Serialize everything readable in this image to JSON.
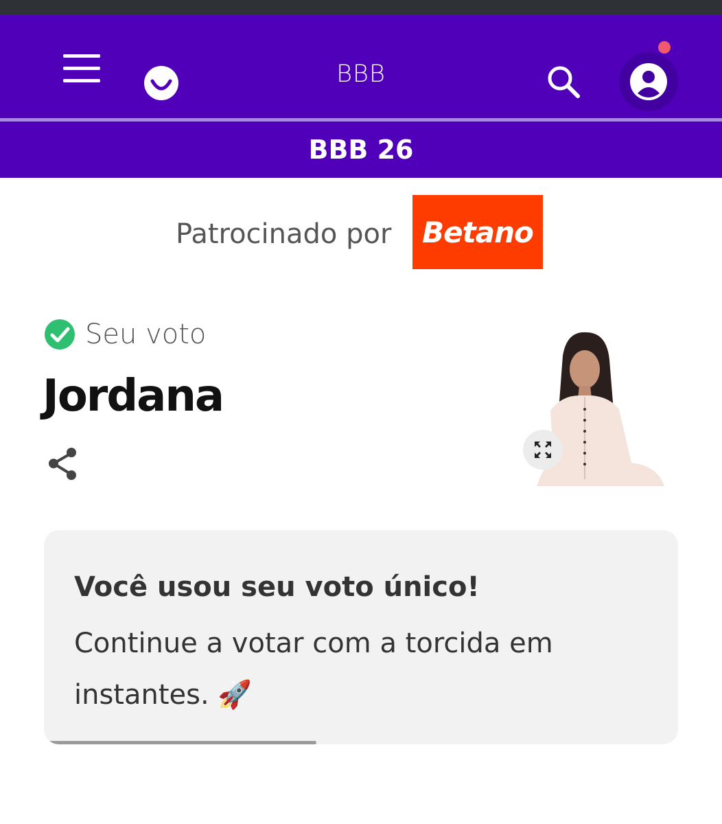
{
  "header": {
    "title": "BBB",
    "section_title": "BBB 26",
    "colors": {
      "brand": "#5000b9",
      "notification": "#f15a6e"
    },
    "icons": [
      "menu-icon",
      "globo-logo-icon",
      "search-icon",
      "user-avatar-icon"
    ]
  },
  "sponsor": {
    "label": "Patrocinado por",
    "logo_text": "Betano",
    "logo_color": "#ff3c00"
  },
  "vote": {
    "status_label": "Seu voto",
    "candidate_name": "Jordana",
    "status_color": "#2fbf71"
  },
  "notice": {
    "title": "Você usou seu voto único!",
    "message": "Continue a votar com a torcida em instantes. 🚀",
    "progress_percent": 43
  }
}
